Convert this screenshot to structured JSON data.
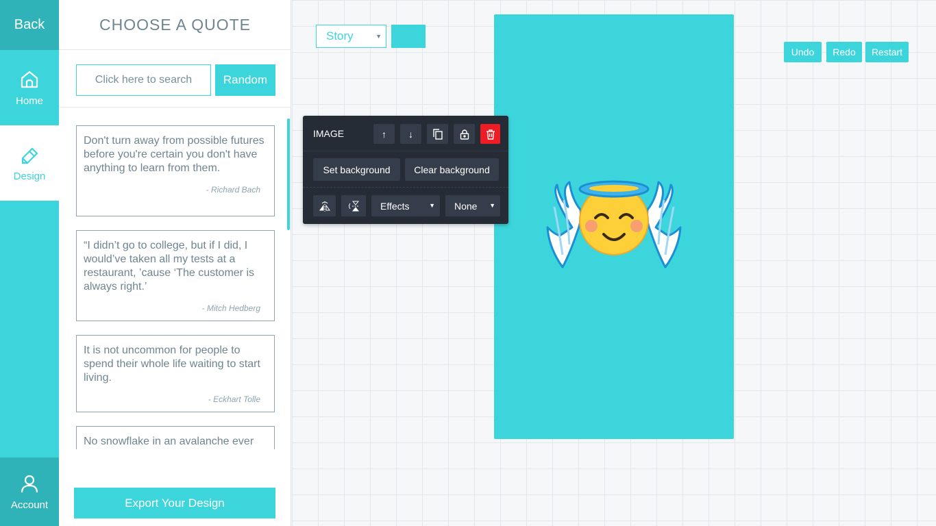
{
  "nav": {
    "back_label": "Back",
    "items": [
      {
        "label": "Home",
        "icon": "home-icon"
      },
      {
        "label": "Design",
        "icon": "pencil-icon"
      },
      {
        "label": "Account",
        "icon": "user-icon"
      }
    ]
  },
  "panel": {
    "title": "CHOOSE A QUOTE",
    "search_placeholder": "Click here to search",
    "random_label": "Random",
    "export_label": "Export Your Design",
    "quotes": [
      {
        "text": "Don't turn away from possible futures before you're certain you don't have anything to learn from them.",
        "author": "- Richard Bach"
      },
      {
        "text": "“I didn’t go to college, but if I did, I would’ve taken all my tests at a restaurant, ’cause ‘The customer is always right.’",
        "author": "- Mitch Hedberg"
      },
      {
        "text": "It is not uncommon for people to spend their whole life waiting to start living.",
        "author": "- Eckhart Tolle"
      },
      {
        "text": "No snowflake in an avalanche ever",
        "author": ""
      }
    ]
  },
  "canvas": {
    "format_select": "Story",
    "bg_color": "#3dd5dc",
    "undo_label": "Undo",
    "redo_label": "Redo",
    "restart_label": "Restart",
    "image_name": "angel-emoji"
  },
  "toolbar": {
    "title": "IMAGE",
    "move_up_label": "↑",
    "move_down_label": "↓",
    "set_background_label": "Set background",
    "clear_background_label": "Clear background",
    "effects_label": "Effects",
    "filter_label": "None",
    "icons": [
      "arrow-up-icon",
      "arrow-down-icon",
      "copy-icon",
      "lock-icon",
      "trash-icon",
      "flip-horizontal-icon",
      "flip-vertical-icon"
    ]
  },
  "colors": {
    "accent": "#3dd5dc",
    "accent_dark": "#2fb3b8",
    "toolbar_bg": "#262c36",
    "delete_red": "#ee1c25"
  }
}
